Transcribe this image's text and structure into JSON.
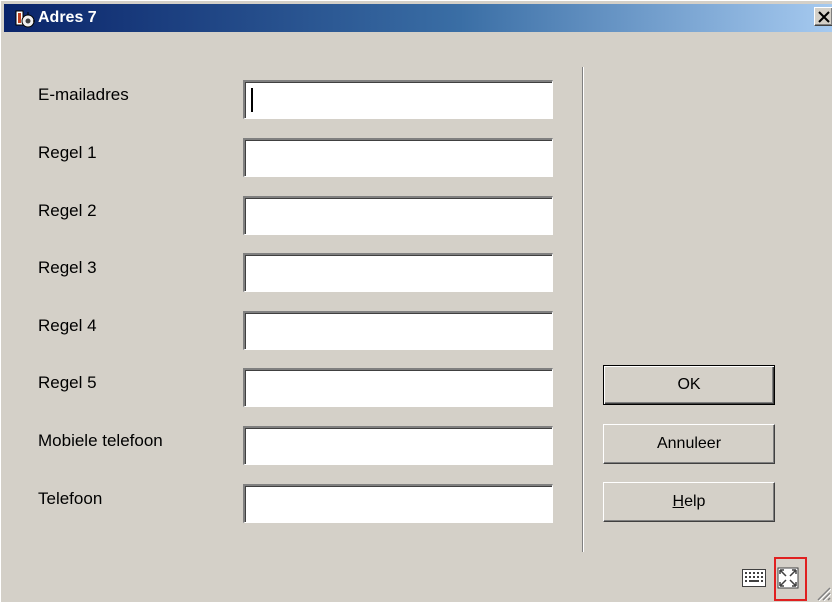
{
  "window": {
    "title": "Adres 7",
    "close_label": "×"
  },
  "fields": [
    {
      "label": "E-mailadres",
      "value": ""
    },
    {
      "label": "Regel 1",
      "value": ""
    },
    {
      "label": "Regel 2",
      "value": ""
    },
    {
      "label": "Regel 3",
      "value": ""
    },
    {
      "label": "Regel 4",
      "value": ""
    },
    {
      "label": "Regel 5",
      "value": ""
    },
    {
      "label": "Mobiele telefoon",
      "value": ""
    },
    {
      "label": "Telefoon",
      "value": ""
    }
  ],
  "buttons": {
    "ok_label": "OK",
    "cancel_label": "Annuleer",
    "help_accel": "H",
    "help_rest": "elp"
  },
  "icons": {
    "app": "library-app-icon",
    "keyboard": "keyboard-icon",
    "resize": "maximize-icon",
    "grip": "resize-grip-icon"
  },
  "colors": {
    "titlebar_start": "#0a246a",
    "titlebar_end": "#a6caf0",
    "window_bg": "#d4d0c8",
    "highlight_box": "#e02020"
  }
}
